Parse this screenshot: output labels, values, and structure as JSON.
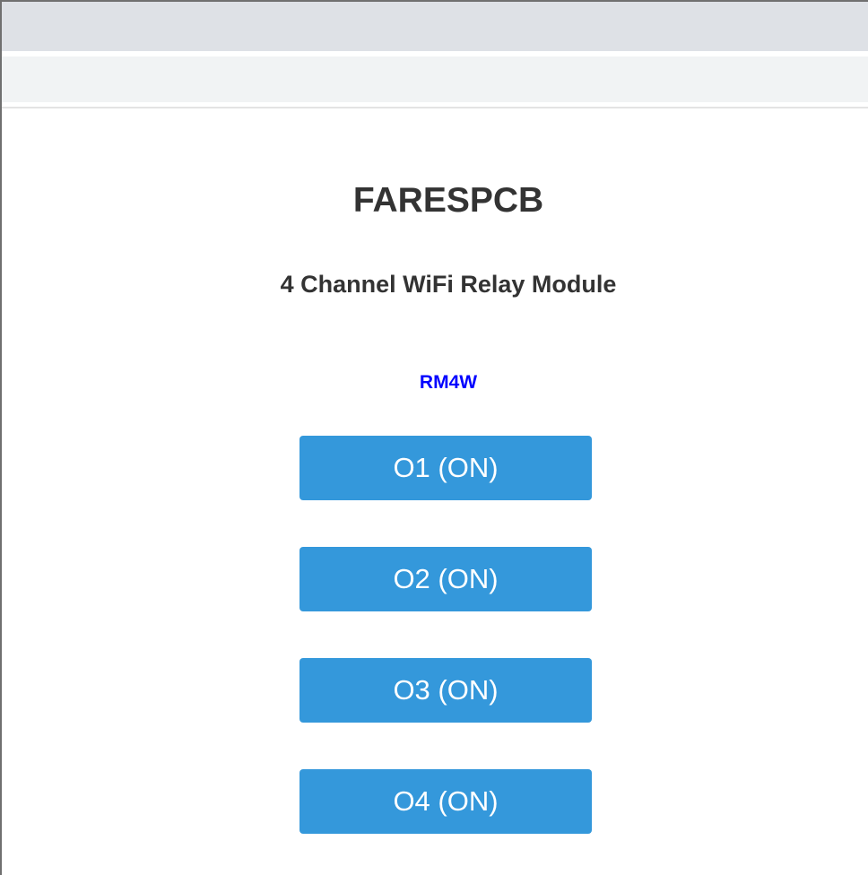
{
  "page": {
    "title": "FARESPCB",
    "subtitle": "4 Channel WiFi Relay Module",
    "model": "RM4W"
  },
  "relays": [
    {
      "label": "O1 (ON)"
    },
    {
      "label": "O2 (ON)"
    },
    {
      "label": "O3 (ON)"
    },
    {
      "label": "O4 (ON)"
    }
  ],
  "colors": {
    "button_background": "#3498db",
    "button_text": "#ffffff",
    "model_text": "#0000ff",
    "heading_text": "#333333",
    "tab_strip": "#dee1e6",
    "address_bar": "#f1f3f4"
  }
}
